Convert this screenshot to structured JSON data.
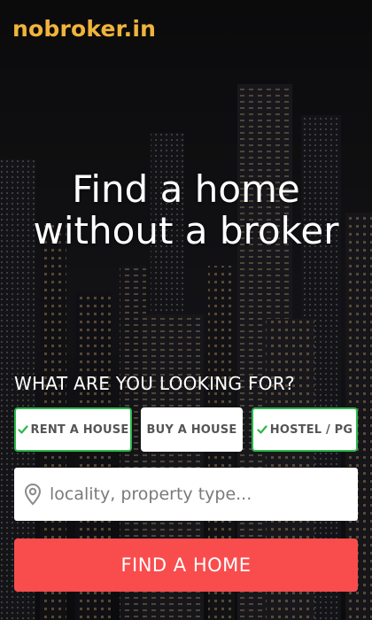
{
  "brand": {
    "logo_text": "nobroker.in",
    "logo_color": "#f0b43c"
  },
  "hero": {
    "line1": "Find a home",
    "line2": "without a broker"
  },
  "search_form": {
    "question": "WHAT ARE YOU LOOKING FOR?",
    "options": [
      {
        "label": "RENT A HOUSE",
        "selected": true,
        "icon": "check-icon"
      },
      {
        "label": "BUY A HOUSE",
        "selected": false
      },
      {
        "label": "HOSTEL / PG",
        "selected": true,
        "icon": "check-icon"
      }
    ],
    "location_input": {
      "value": "",
      "placeholder": "locality, property type...",
      "icon": "location-pin-icon"
    },
    "submit_label": "FIND A HOME"
  },
  "colors": {
    "selected_border": "#2bb84a",
    "cta_background": "#f94d4d"
  }
}
